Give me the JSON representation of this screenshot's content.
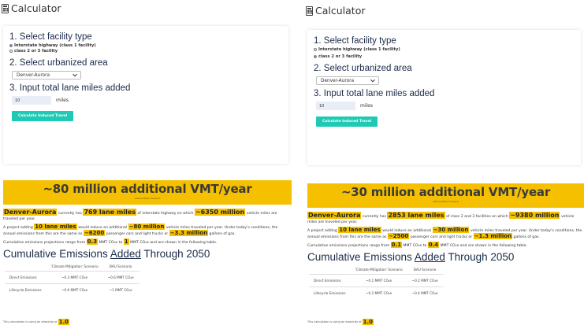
{
  "left": {
    "app_title": "Calculator",
    "step1_title": "1. Select facility type",
    "facility_options": [
      {
        "label": "Interstate highway (class 1 facility)",
        "selected": true
      },
      {
        "label": "class 2 or 3 facility",
        "selected": false
      }
    ],
    "step2_title": "2. Select urbanized area",
    "urbanized_area": "Denver-Aurora",
    "step3_title": "3. Input total lane miles added",
    "lane_miles_value": "10",
    "lane_miles_unit": "miles",
    "calc_button": "Calculate Induced Travel",
    "banner_main": "~80 million additional VMT/year",
    "banner_sub": "(Vehicle Miles Traveled)",
    "p1": {
      "area": "Denver-Aurora",
      "t1": "currently has",
      "lane_miles": "769 lane miles",
      "t2": "of interstate highway on which",
      "vmt": "~6350 million",
      "t3": "vehicle miles are traveled per year."
    },
    "p2": {
      "t1": "A project adding",
      "added": "10 lane miles",
      "t2": "would induce an additional",
      "induced": "~80 million",
      "t3": "vehicle miles traveled per year. Under today's conditions, the annual emissions from this are the same as",
      "cars": "~6200",
      "t4": "passenger cars and light trucks or",
      "gas": "~3.3 million",
      "t5": "gallons of gas."
    },
    "p3": {
      "t1": "Cumulative emissions projections range from",
      "min": "0.3",
      "t2": "MMT CO₂e to",
      "max": "1",
      "t3": "MMT CO₂e and are shown in the following table."
    },
    "cum_title_pre": "Cumulative Emissions ",
    "cum_title_u": "Added",
    "cum_title_post": " Through 2050",
    "table": {
      "headers": [
        "",
        "'Climate Mitigation' Scenario",
        "BAU Scenario"
      ],
      "rows": [
        [
          "Direct Emissions",
          "~0.3 MMT CO₂e",
          "~0.6 MMT CO₂e"
        ],
        [
          "Lifecycle Emissions",
          "~0.6 MMT CO₂e",
          "~1 MMT CO₂e"
        ]
      ]
    },
    "elasticity_text": "This calculation is using an elasticity of",
    "elasticity_value": "1.0"
  },
  "right": {
    "app_title": "Calculator",
    "step1_title": "1. Select facility type",
    "facility_options": [
      {
        "label": "Interstate highway (class 1 facility)",
        "selected": false
      },
      {
        "label": "class 2 or 3 facility",
        "selected": true
      }
    ],
    "step2_title": "2. Select urbanized area",
    "urbanized_area": "Denver-Aurora",
    "step3_title": "3. Input total lane miles added",
    "lane_miles_value": "10",
    "lane_miles_unit": "miles",
    "calc_button": "Calculate Induced Travel",
    "banner_main": "~30 million additional VMT/year",
    "banner_sub": "(Vehicle Miles Traveled)",
    "p1": {
      "area": "Denver-Aurora",
      "t1": "currently has",
      "lane_miles": "2853 lane miles",
      "t2": "of class 2 and 3 facilities on which",
      "vmt": "~9380 million",
      "t3": "vehicle miles are traveled per year."
    },
    "p2": {
      "t1": "A project adding",
      "added": "10 lane miles",
      "t2": "would induce an additional",
      "induced": "~30 million",
      "t3": "vehicle miles traveled per year. Under today's conditions, the annual emissions from this are the same as",
      "cars": "~2500",
      "t4": "passenger cars and light trucks or",
      "gas": "~1.3 million",
      "t5": "gallons of gas."
    },
    "p3": {
      "t1": "Cumulative emissions projections range from",
      "min": "0.1",
      "t2": "MMT CO₂e to",
      "max": "0.4",
      "t3": "MMT CO₂e and are shown in the following table."
    },
    "cum_title_pre": "Cumulative Emissions ",
    "cum_title_u": "Added",
    "cum_title_post": " Through 2050",
    "table": {
      "headers": [
        "",
        "'Climate Mitigation' Scenario",
        "BAU Scenario"
      ],
      "rows": [
        [
          "Direct Emissions",
          "~0.1 MMT CO₂e",
          "~0.2 MMT CO₂e"
        ],
        [
          "Lifecycle Emissions",
          "~0.2 MMT CO₂e",
          "~0.4 MMT CO₂e"
        ]
      ]
    },
    "elasticity_text": "This calculation is using an elasticity of",
    "elasticity_value": "1.0"
  },
  "colors": {
    "accent_yellow": "#f5c000",
    "button_teal": "#1ec9b5",
    "heading_navy": "#1a2b48"
  }
}
